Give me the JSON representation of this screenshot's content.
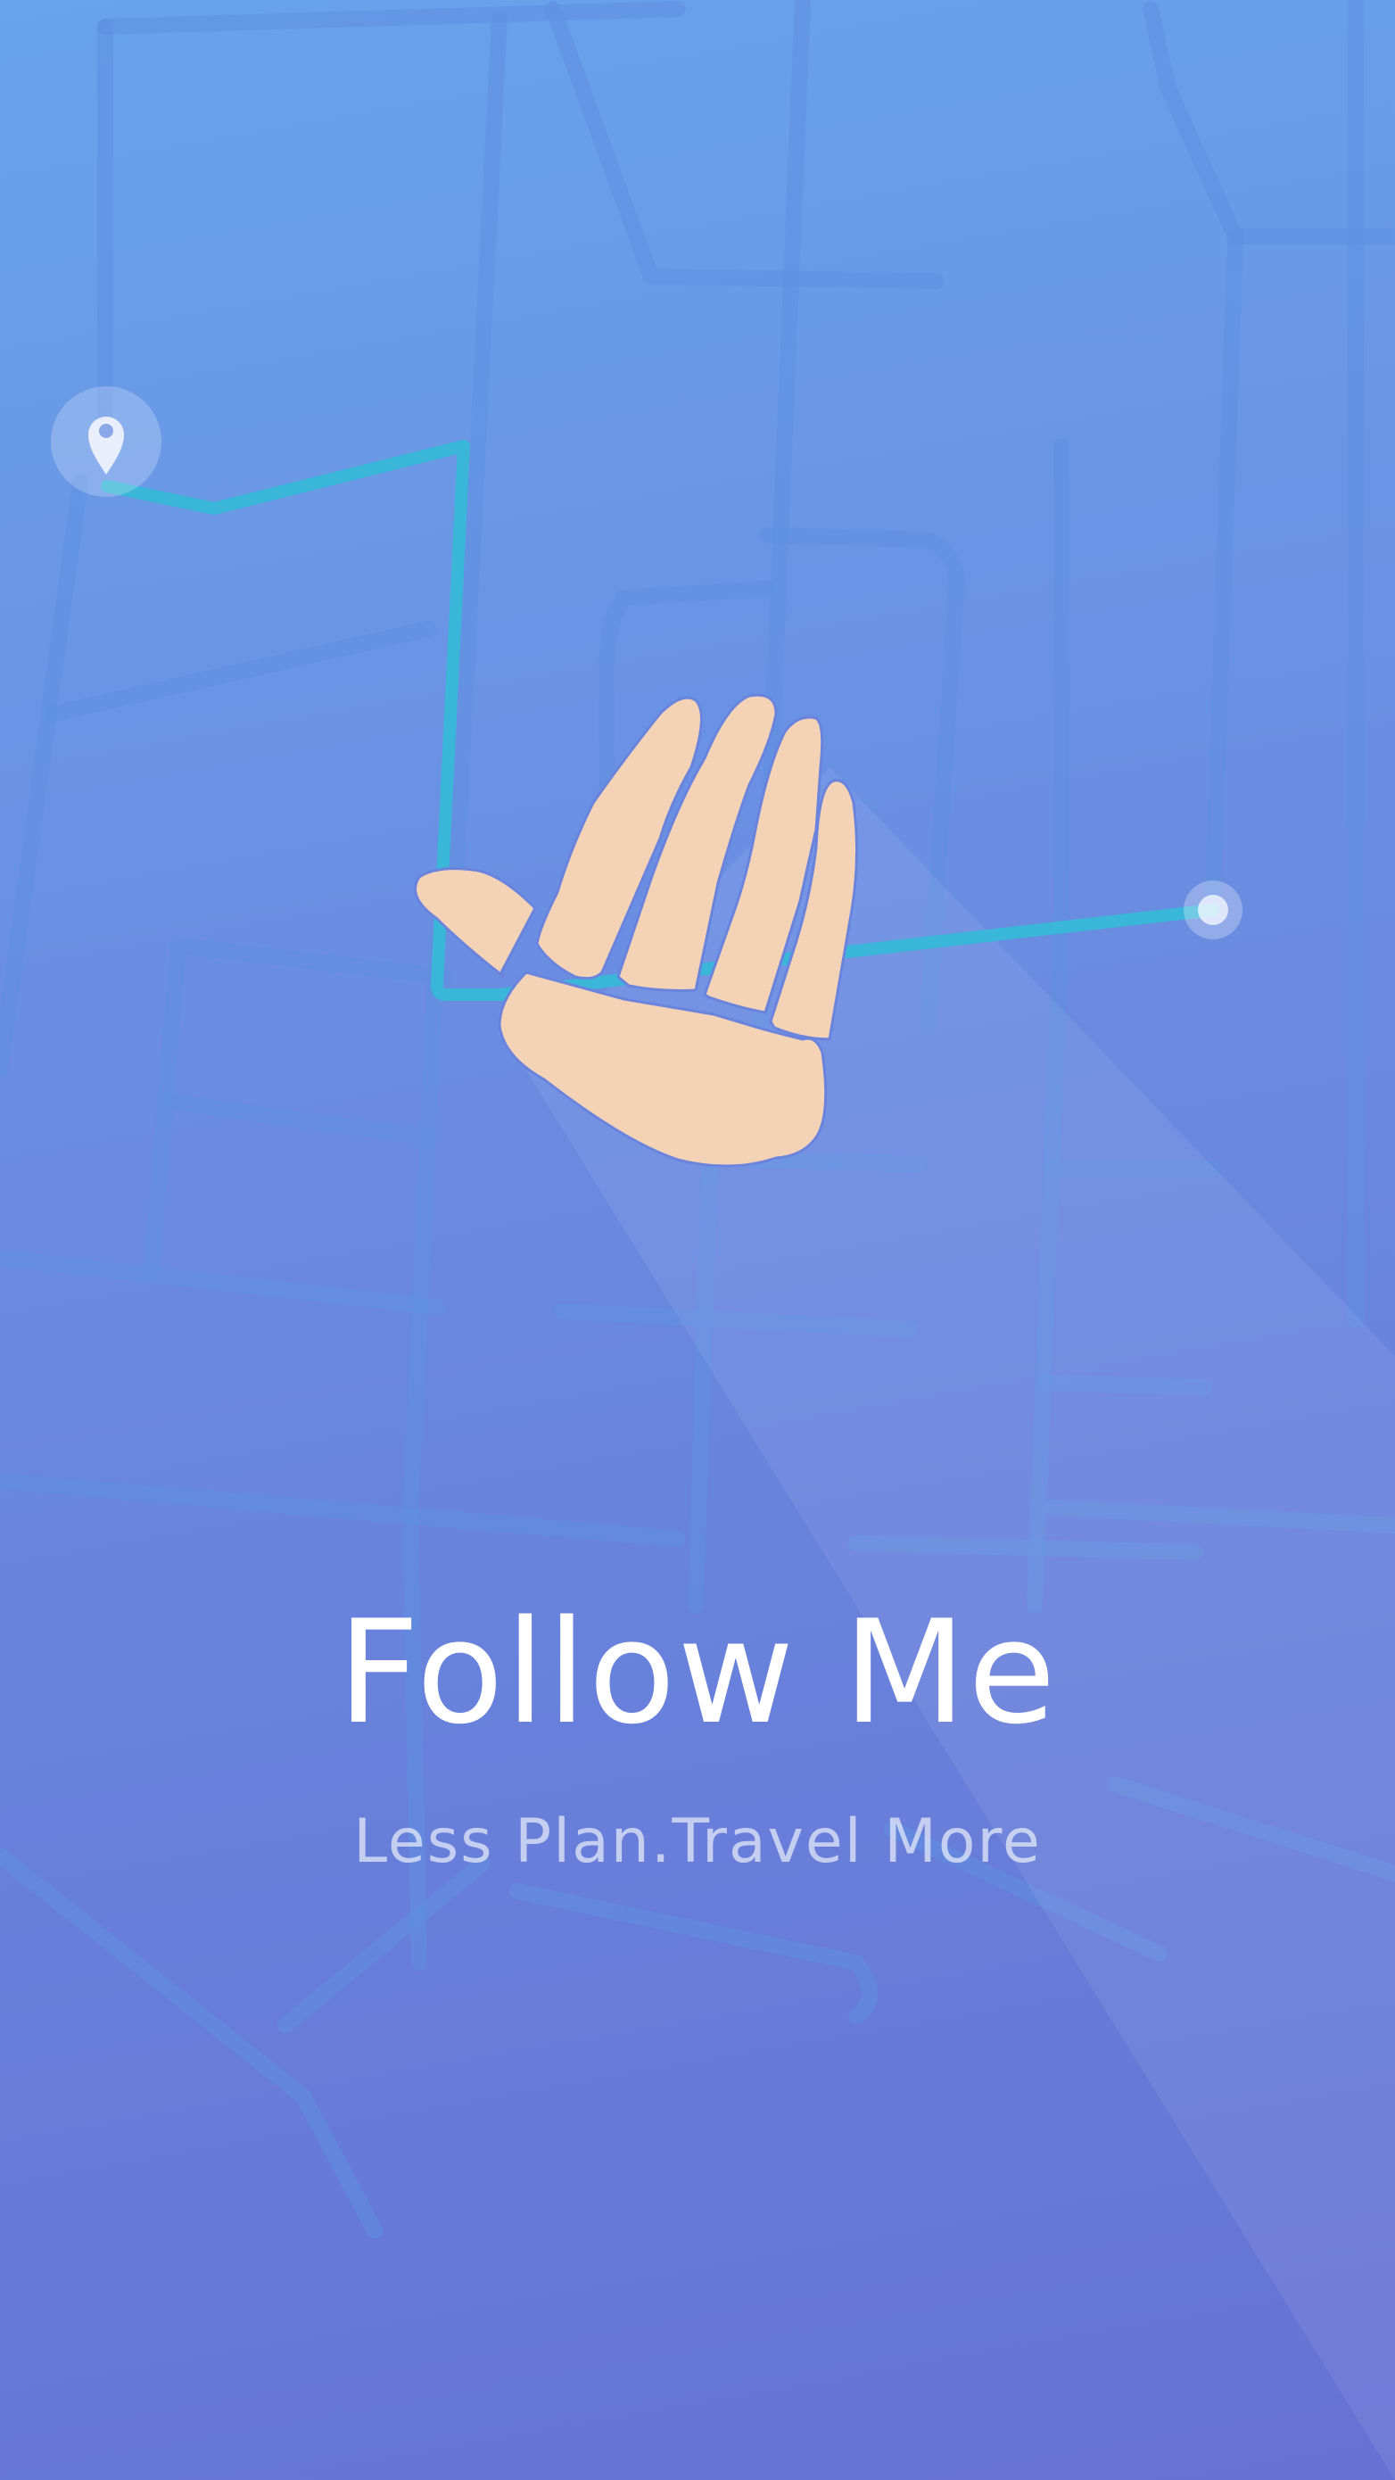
{
  "onboarding": {
    "title": "Follow Me",
    "subtitle": "Less Plan.Travel More"
  },
  "icons": {
    "start": "location-pin-icon",
    "end": "destination-dot-icon",
    "hero": "waving-hand-icon"
  },
  "colors": {
    "background_top": "#69a3ec",
    "background_bottom": "#6672d3",
    "route": "#3ab6d8",
    "hand": "#f4d2b6"
  }
}
